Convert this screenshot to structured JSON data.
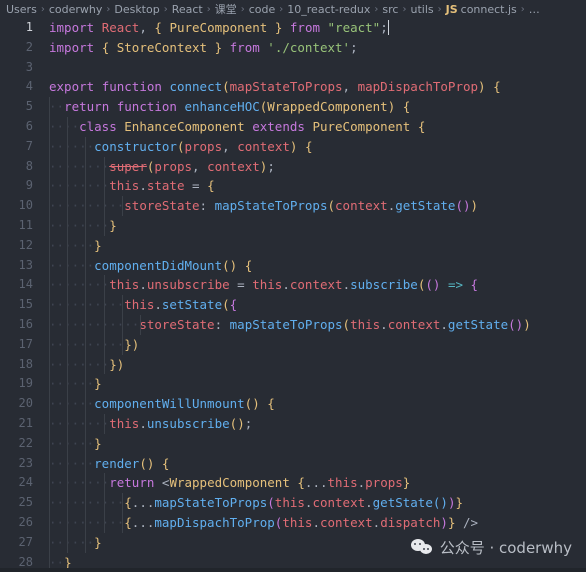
{
  "breadcrumb": {
    "items": [
      {
        "label": "Users",
        "type": "folder"
      },
      {
        "label": "coderwhy",
        "type": "folder"
      },
      {
        "label": "Desktop",
        "type": "folder"
      },
      {
        "label": "React",
        "type": "folder"
      },
      {
        "label": "课堂",
        "type": "folder"
      },
      {
        "label": "code",
        "type": "folder"
      },
      {
        "label": "10_react-redux",
        "type": "folder"
      },
      {
        "label": "src",
        "type": "folder"
      },
      {
        "label": "utils",
        "type": "folder"
      },
      {
        "label": "connect.js",
        "type": "file",
        "badge": "JS"
      },
      {
        "label": "…",
        "type": "symbol"
      }
    ],
    "separator": "›"
  },
  "editor": {
    "language": "javascript",
    "file_name": "connect.js",
    "active_line": 1,
    "cursor": {
      "line": 1,
      "column": 47
    },
    "line_numbers": [
      1,
      2,
      3,
      4,
      5,
      6,
      7,
      8,
      9,
      10,
      11,
      12,
      13,
      14,
      15,
      16,
      17,
      18,
      19,
      20,
      21,
      22,
      23,
      24,
      25,
      26,
      27,
      28
    ],
    "lines": [
      {
        "n": 1,
        "indent": 0,
        "text": "import React, { PureComponent } from \"react\";"
      },
      {
        "n": 2,
        "indent": 0,
        "text": "import { StoreContext } from './context';"
      },
      {
        "n": 3,
        "indent": 0,
        "text": ""
      },
      {
        "n": 4,
        "indent": 0,
        "text": "export function connect(mapStateToProps, mapDispachToProp) {"
      },
      {
        "n": 5,
        "indent": 1,
        "text": "return function enhanceHOC(WrappedComponent) {"
      },
      {
        "n": 6,
        "indent": 2,
        "text": "class EnhanceComponent extends PureComponent {"
      },
      {
        "n": 7,
        "indent": 3,
        "text": "constructor(props, context) {"
      },
      {
        "n": 8,
        "indent": 4,
        "text": "super(props, context);"
      },
      {
        "n": 9,
        "indent": 4,
        "text": "this.state = {"
      },
      {
        "n": 10,
        "indent": 5,
        "text": "storeState: mapStateToProps(context.getState())"
      },
      {
        "n": 11,
        "indent": 4,
        "text": "}"
      },
      {
        "n": 12,
        "indent": 3,
        "text": "}"
      },
      {
        "n": 13,
        "indent": 3,
        "text": "componentDidMount() {"
      },
      {
        "n": 14,
        "indent": 4,
        "text": "this.unsubscribe = this.context.subscribe(() => {"
      },
      {
        "n": 15,
        "indent": 5,
        "text": "this.setState({"
      },
      {
        "n": 16,
        "indent": 6,
        "text": "storeState: mapStateToProps(this.context.getState())"
      },
      {
        "n": 17,
        "indent": 5,
        "text": "})"
      },
      {
        "n": 18,
        "indent": 4,
        "text": "})"
      },
      {
        "n": 19,
        "indent": 3,
        "text": "}"
      },
      {
        "n": 20,
        "indent": 3,
        "text": "componentWillUnmount() {"
      },
      {
        "n": 21,
        "indent": 4,
        "text": "this.unsubscribe();"
      },
      {
        "n": 22,
        "indent": 3,
        "text": "}"
      },
      {
        "n": 23,
        "indent": 3,
        "text": "render() {"
      },
      {
        "n": 24,
        "indent": 4,
        "text": "return <WrappedComponent {...this.props}"
      },
      {
        "n": 25,
        "indent": 5,
        "text": "{...mapStateToProps(this.context.getState())}"
      },
      {
        "n": 26,
        "indent": 5,
        "text": "{...mapDispachToProp(this.context.dispatch)} />"
      },
      {
        "n": 27,
        "indent": 3,
        "text": "}"
      },
      {
        "n": 28,
        "indent": 1,
        "text": "}"
      }
    ]
  },
  "watermark": {
    "icon": "wechat-icon",
    "text": "公众号 · coderwhy"
  },
  "colors": {
    "background": "#282c34",
    "chrome": "#21252b",
    "gutter_text": "#5b6270",
    "gutter_active": "#d0d4da",
    "keyword": "#c678dd",
    "variable": "#e06c75",
    "string": "#98c379",
    "function": "#61afef",
    "class": "#e5c07b",
    "operator": "#56b6c2",
    "plain": "#abb2bf",
    "indent_guide": "#3b4048",
    "breadcrumb_text": "#9aa2ae",
    "js_badge": "#e5c07b"
  }
}
